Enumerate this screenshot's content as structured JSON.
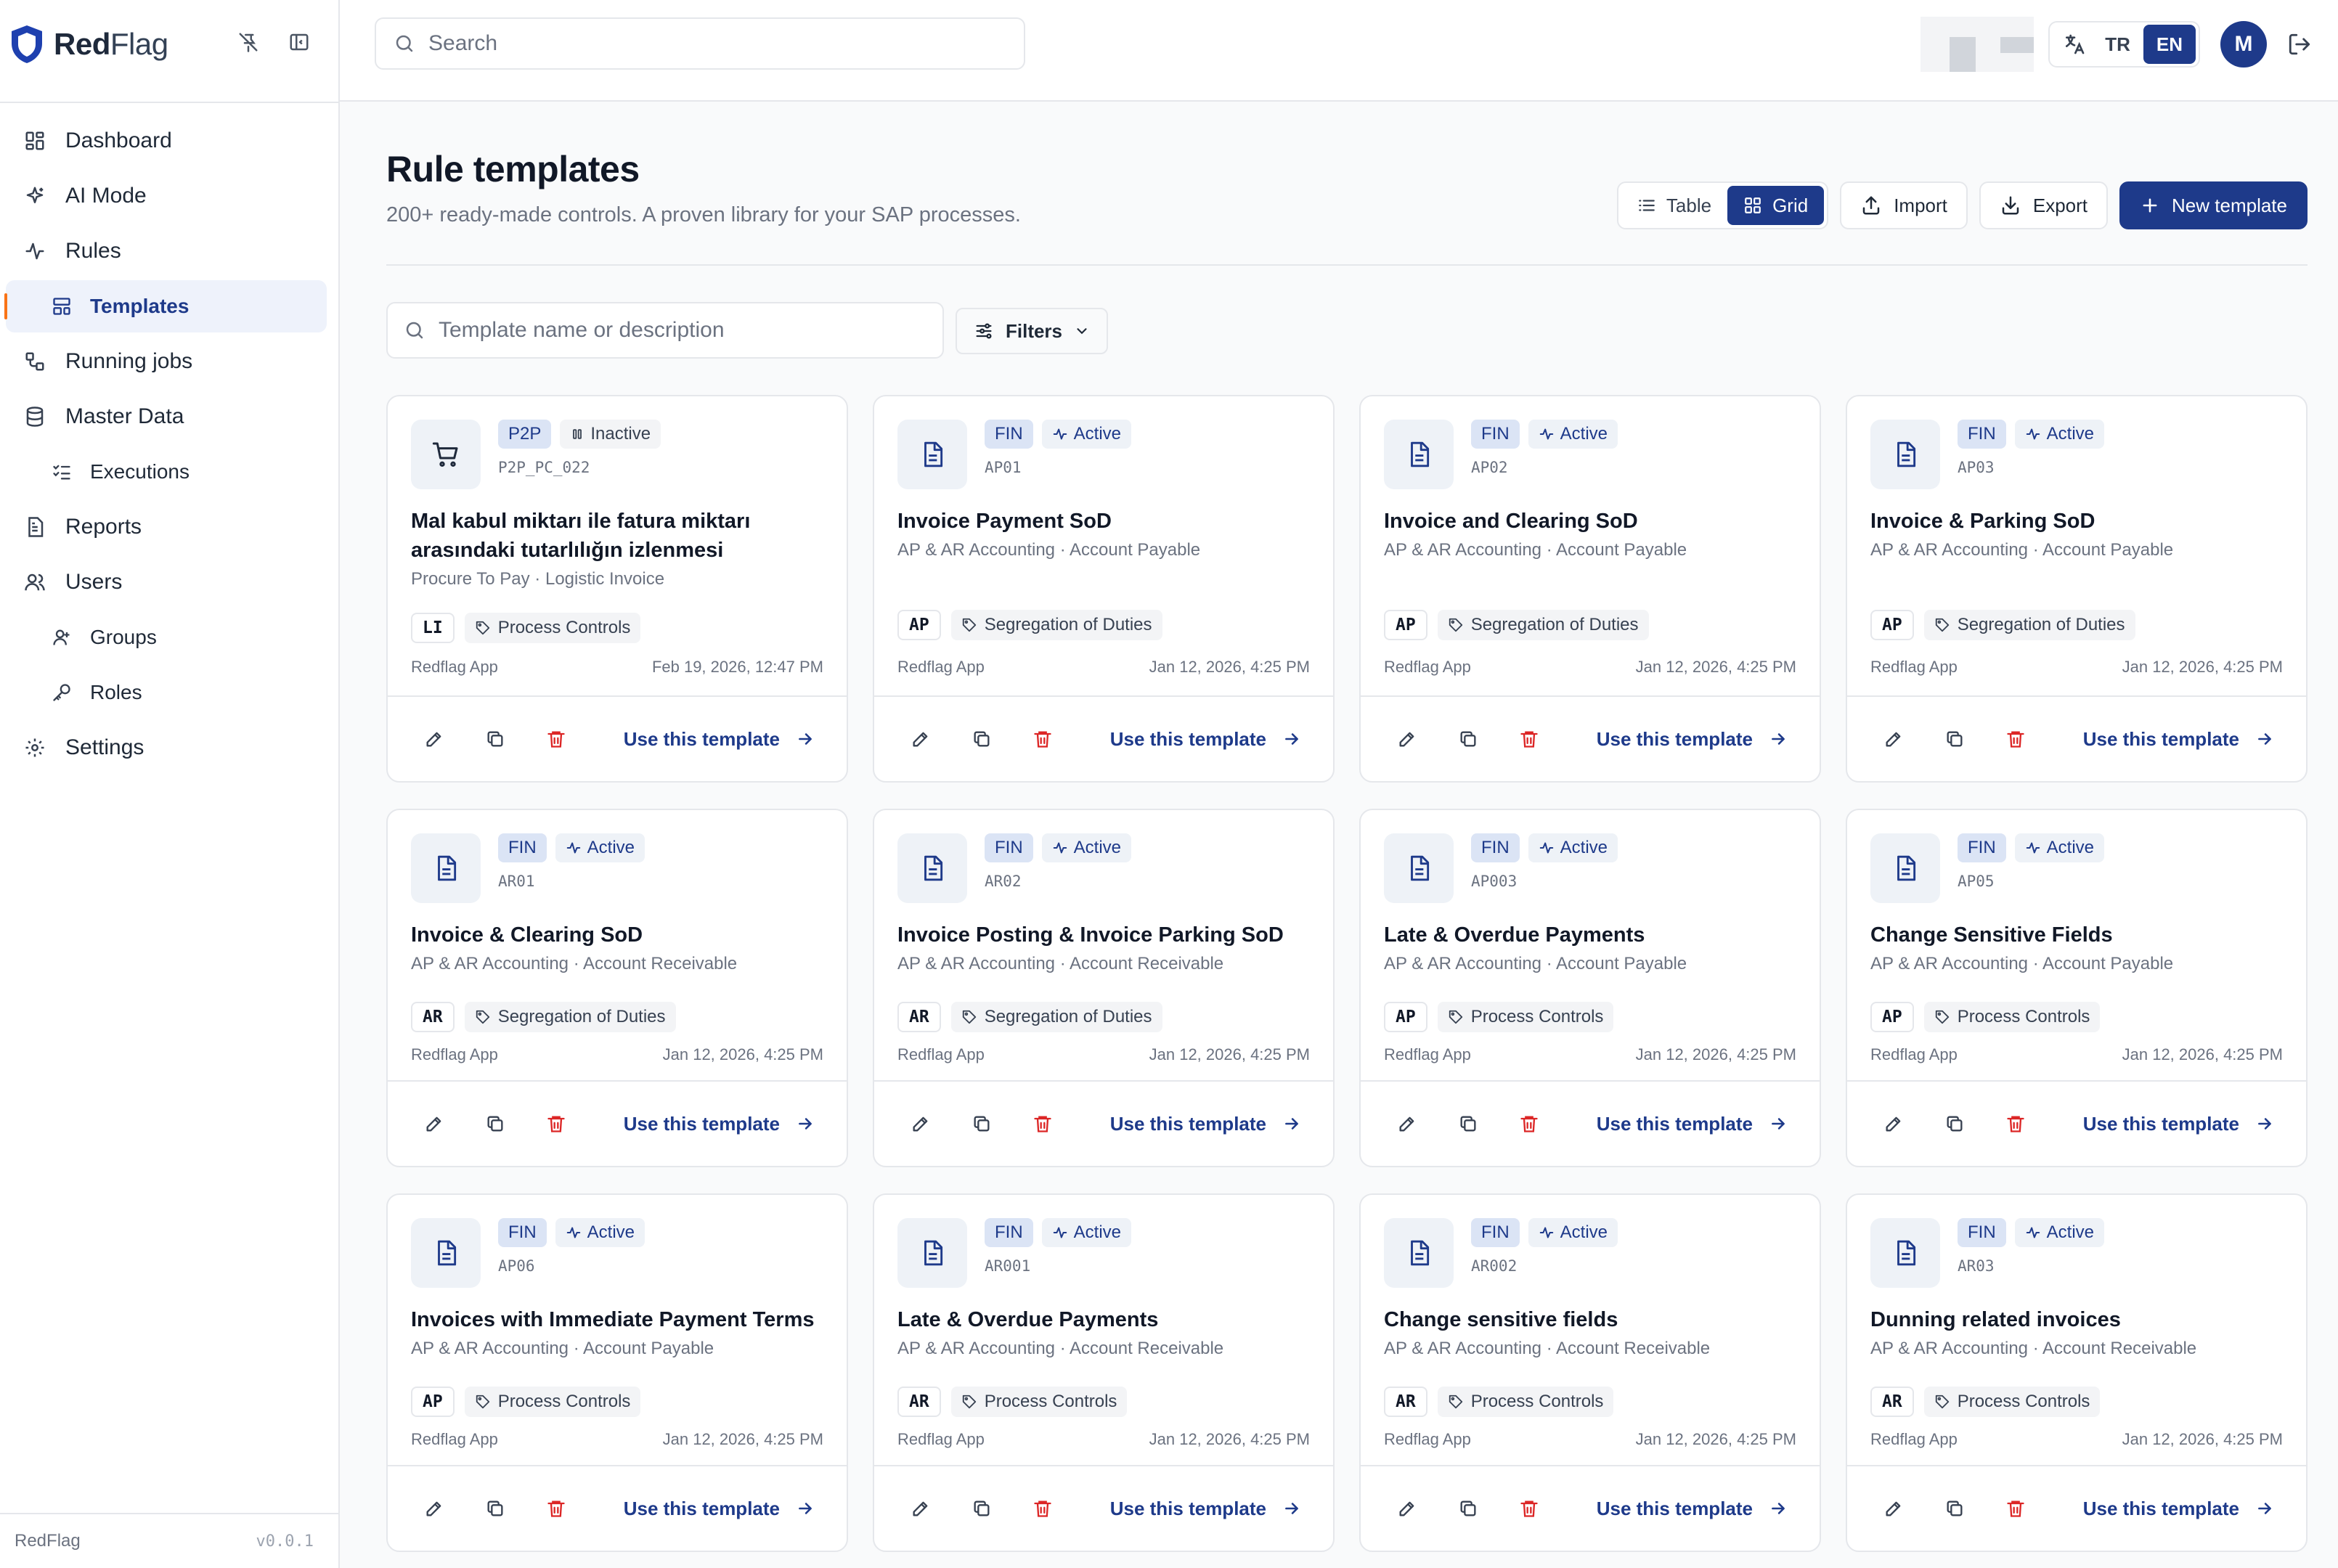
{
  "app": {
    "brand_bold": "Red",
    "brand_light": "Flag",
    "footer_name": "RedFlag",
    "version": "v0.0.1"
  },
  "sidebar": {
    "items": [
      {
        "label": "Dashboard",
        "icon": "dashboard-icon"
      },
      {
        "label": "AI Mode",
        "icon": "sparkles-icon"
      },
      {
        "label": "Rules",
        "icon": "activity-icon"
      },
      {
        "label": "Templates",
        "icon": "layout-template-icon",
        "active": true
      },
      {
        "label": "Running jobs",
        "icon": "workflow-icon"
      },
      {
        "label": "Master Data",
        "icon": "database-icon"
      },
      {
        "label": "Executions",
        "icon": "list-checks-icon"
      },
      {
        "label": "Reports",
        "icon": "file-report-icon"
      },
      {
        "label": "Users",
        "icon": "users-icon"
      },
      {
        "label": "Groups",
        "icon": "user-group-icon"
      },
      {
        "label": "Roles",
        "icon": "key-icon"
      },
      {
        "label": "Settings",
        "icon": "gear-icon"
      }
    ]
  },
  "topbar": {
    "search_placeholder": "Search",
    "lang_tr": "TR",
    "lang_en": "EN",
    "avatar_initial": "M"
  },
  "page": {
    "title": "Rule templates",
    "subtitle": "200+ ready-made controls. A proven library for your SAP processes.",
    "view_table": "Table",
    "view_grid": "Grid",
    "import_label": "Import",
    "export_label": "Export",
    "new_label": "New template",
    "filter_placeholder": "Template name or description",
    "filters_label": "Filters",
    "use_label": "Use this template"
  },
  "templates": [
    {
      "module": "P2P",
      "status": "Inactive",
      "code": "P2P_PC_022",
      "title": "Mal kabul miktarı ile fatura miktarı arasındaki tutarlılığın izlenmesi",
      "subtitle": "Procure To Pay · Logistic Invoice",
      "tag": "LI",
      "category": "Process Controls",
      "author": "Redflag App",
      "date": "Feb 19, 2026, 12:47 PM"
    },
    {
      "module": "FIN",
      "status": "Active",
      "code": "AP01",
      "title": "Invoice Payment SoD",
      "subtitle": "AP & AR Accounting · Account Payable",
      "tag": "AP",
      "category": "Segregation of Duties",
      "author": "Redflag App",
      "date": "Jan 12, 2026, 4:25 PM"
    },
    {
      "module": "FIN",
      "status": "Active",
      "code": "AP02",
      "title": "Invoice and Clearing SoD",
      "subtitle": "AP & AR Accounting · Account Payable",
      "tag": "AP",
      "category": "Segregation of Duties",
      "author": "Redflag App",
      "date": "Jan 12, 2026, 4:25 PM"
    },
    {
      "module": "FIN",
      "status": "Active",
      "code": "AP03",
      "title": "Invoice & Parking SoD",
      "subtitle": "AP & AR Accounting · Account Payable",
      "tag": "AP",
      "category": "Segregation of Duties",
      "author": "Redflag App",
      "date": "Jan 12, 2026, 4:25 PM"
    },
    {
      "module": "FIN",
      "status": "Active",
      "code": "AR01",
      "title": "Invoice & Clearing SoD",
      "subtitle": "AP & AR Accounting · Account Receivable",
      "tag": "AR",
      "category": "Segregation of Duties",
      "author": "Redflag App",
      "date": "Jan 12, 2026, 4:25 PM"
    },
    {
      "module": "FIN",
      "status": "Active",
      "code": "AR02",
      "title": "Invoice Posting & Invoice Parking SoD",
      "subtitle": "AP & AR Accounting · Account Receivable",
      "tag": "AR",
      "category": "Segregation of Duties",
      "author": "Redflag App",
      "date": "Jan 12, 2026, 4:25 PM"
    },
    {
      "module": "FIN",
      "status": "Active",
      "code": "AP003",
      "title": "Late & Overdue Payments",
      "subtitle": "AP & AR Accounting · Account Payable",
      "tag": "AP",
      "category": "Process Controls",
      "author": "Redflag App",
      "date": "Jan 12, 2026, 4:25 PM"
    },
    {
      "module": "FIN",
      "status": "Active",
      "code": "AP05",
      "title": "Change Sensitive Fields",
      "subtitle": "AP & AR Accounting · Account Payable",
      "tag": "AP",
      "category": "Process Controls",
      "author": "Redflag App",
      "date": "Jan 12, 2026, 4:25 PM"
    },
    {
      "module": "FIN",
      "status": "Active",
      "code": "AP06",
      "title": "Invoices with Immediate Payment Terms",
      "subtitle": "AP & AR Accounting · Account Payable",
      "tag": "AP",
      "category": "Process Controls",
      "author": "Redflag App",
      "date": "Jan 12, 2026, 4:25 PM"
    },
    {
      "module": "FIN",
      "status": "Active",
      "code": "AR001",
      "title": "Late & Overdue Payments",
      "subtitle": "AP & AR Accounting · Account Receivable",
      "tag": "AR",
      "category": "Process Controls",
      "author": "Redflag App",
      "date": "Jan 12, 2026, 4:25 PM"
    },
    {
      "module": "FIN",
      "status": "Active",
      "code": "AR002",
      "title": "Change sensitive fields",
      "subtitle": "AP & AR Accounting · Account Receivable",
      "tag": "AR",
      "category": "Process Controls",
      "author": "Redflag App",
      "date": "Jan 12, 2026, 4:25 PM"
    },
    {
      "module": "FIN",
      "status": "Active",
      "code": "AR03",
      "title": "Dunning related invoices",
      "subtitle": "AP & AR Accounting · Account Receivable",
      "tag": "AR",
      "category": "Process Controls",
      "author": "Redflag App",
      "date": "Jan 12, 2026, 4:25 PM"
    }
  ],
  "colors": {
    "brand": "#1e3a8a",
    "accent_active_bar": "#f97316",
    "delete": "#dc2626"
  }
}
